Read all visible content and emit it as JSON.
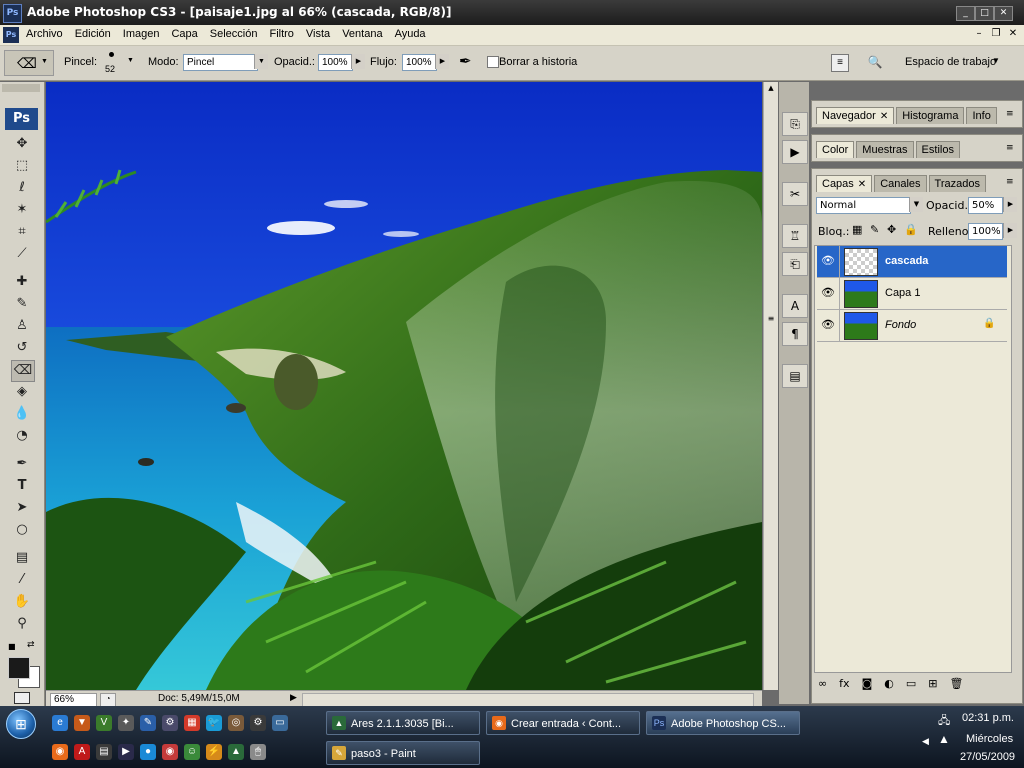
{
  "window": {
    "title": "Adobe Photoshop CS3 - [paisaje1.jpg al 66% (cascada, RGB/8)]",
    "app_icon": "Ps",
    "controls": {
      "minimize": "_",
      "restore": "□",
      "close": "✕"
    }
  },
  "menu": {
    "items": [
      "Archivo",
      "Edición",
      "Imagen",
      "Capa",
      "Selección",
      "Filtro",
      "Vista",
      "Ventana",
      "Ayuda"
    ],
    "doc_controls": {
      "minimize": "–",
      "restore": "❐",
      "close": "✕"
    }
  },
  "options": {
    "brush_label": "Pincel:",
    "brush_size": "52",
    "mode_label": "Modo:",
    "mode_value": "Pincel",
    "opacity_label": "Opacid.:",
    "opacity_value": "100%",
    "flow_label": "Flujo:",
    "flow_value": "100%",
    "history_label": "Borrar a historia",
    "workspace_label": "Espacio de trabajo"
  },
  "tools": {
    "logo": "Ps"
  },
  "status": {
    "zoom": "66%",
    "doc": "Doc: 5,49M/15,0M"
  },
  "panels": {
    "group1_tabs": [
      "Navegador",
      "Histograma",
      "Info"
    ],
    "group2_tabs": [
      "Color",
      "Muestras",
      "Estilos"
    ],
    "group3_tabs": [
      "Capas",
      "Canales",
      "Trazados"
    ],
    "blend_mode": "Normal",
    "opacity_label": "Opacid.:",
    "opacity_value": "50%",
    "lock_label": "Bloq.:",
    "fill_label": "Relleno:",
    "fill_value": "100%",
    "layers": [
      {
        "name": "cascada",
        "selected": true
      },
      {
        "name": "Capa 1",
        "selected": false
      },
      {
        "name": "Fondo",
        "selected": false,
        "locked": true
      }
    ]
  },
  "taskbar": {
    "row1": [
      {
        "label": "Ares 2.1.1.3035  [Bi...",
        "icon": "ares-icon"
      },
      {
        "label": "Crear entrada ‹ Cont...",
        "icon": "firefox-icon"
      },
      {
        "label": "Adobe Photoshop CS...",
        "icon": "photoshop-icon",
        "active": true
      }
    ],
    "row2": [
      {
        "label": "paso3 - Paint",
        "icon": "paint-icon"
      }
    ],
    "time": "02:31 p.m.",
    "day": "Miércoles",
    "date": "27/05/2009"
  },
  "colors": {
    "selection": "#2766c8",
    "panel_bg": "#d6d3c8",
    "app_bg": "#6b6b6b"
  }
}
